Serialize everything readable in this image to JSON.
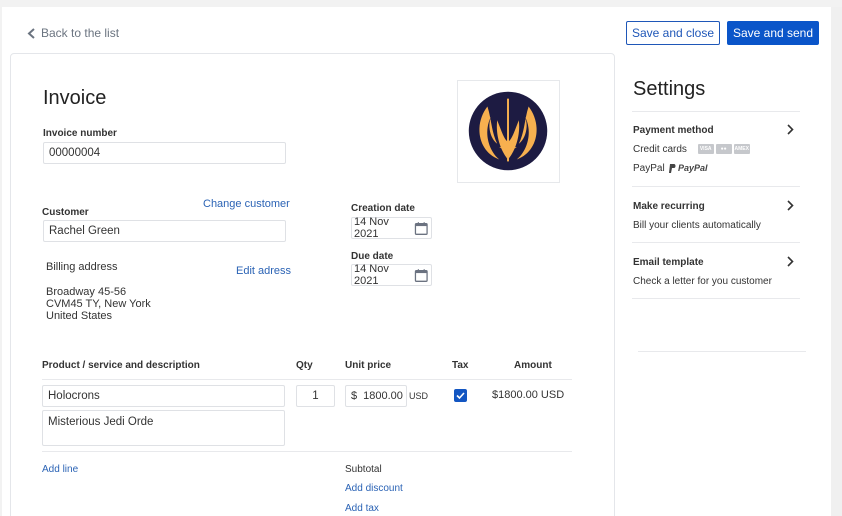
{
  "nav": {
    "back_label": "Back to the list"
  },
  "actions": {
    "save_close": "Save and close",
    "save_send": "Save and send"
  },
  "invoice": {
    "title": "Invoice",
    "number_label": "Invoice number",
    "number_value": "00000004",
    "customer_label": "Customer",
    "customer_value": "Rachel Green",
    "change_customer": "Change customer",
    "billing_label": "Billing address",
    "edit_address": "Edit adress",
    "address_lines": [
      "Broadway 45-56",
      "CVM45 TY, New York",
      "United States"
    ],
    "creation_date_label": "Creation date",
    "creation_date_value": "14 Nov 2021",
    "due_date_label": "Due date",
    "due_date_value": "14 Nov 2021",
    "logo_colors": {
      "circle": "#1d1b42",
      "emblem": "#f7b04f"
    }
  },
  "table": {
    "headers": {
      "product": "Product / service and description",
      "qty": "Qty",
      "unit_price": "Unit price",
      "tax": "Tax",
      "amount": "Amount"
    },
    "rows": [
      {
        "product": "Holocrons",
        "description": "Misterious Jedi Orde",
        "qty": "1",
        "currency_symbol": "$",
        "unit_price": "1800.00",
        "currency": "USD",
        "tax_checked": true,
        "amount": "$1800.00 USD"
      }
    ],
    "add_line": "Add line",
    "subtotal_label": "Subtotal",
    "add_discount": "Add discount",
    "add_tax": "Add tax"
  },
  "settings": {
    "title": "Settings",
    "payment": {
      "label": "Payment method",
      "credit_cards": "Credit cards",
      "card_icons": [
        "visa-icon",
        "mastercard-icon",
        "amex-icon"
      ],
      "paypal": "PayPal",
      "paypal_logo": "PayPal"
    },
    "recurring": {
      "label": "Make recurring",
      "sub": "Bill your clients automatically"
    },
    "email": {
      "label": "Email template",
      "sub": "Check a letter for you customer"
    }
  },
  "colors": {
    "primary": "#0a55c9",
    "link": "#2b63b5"
  }
}
